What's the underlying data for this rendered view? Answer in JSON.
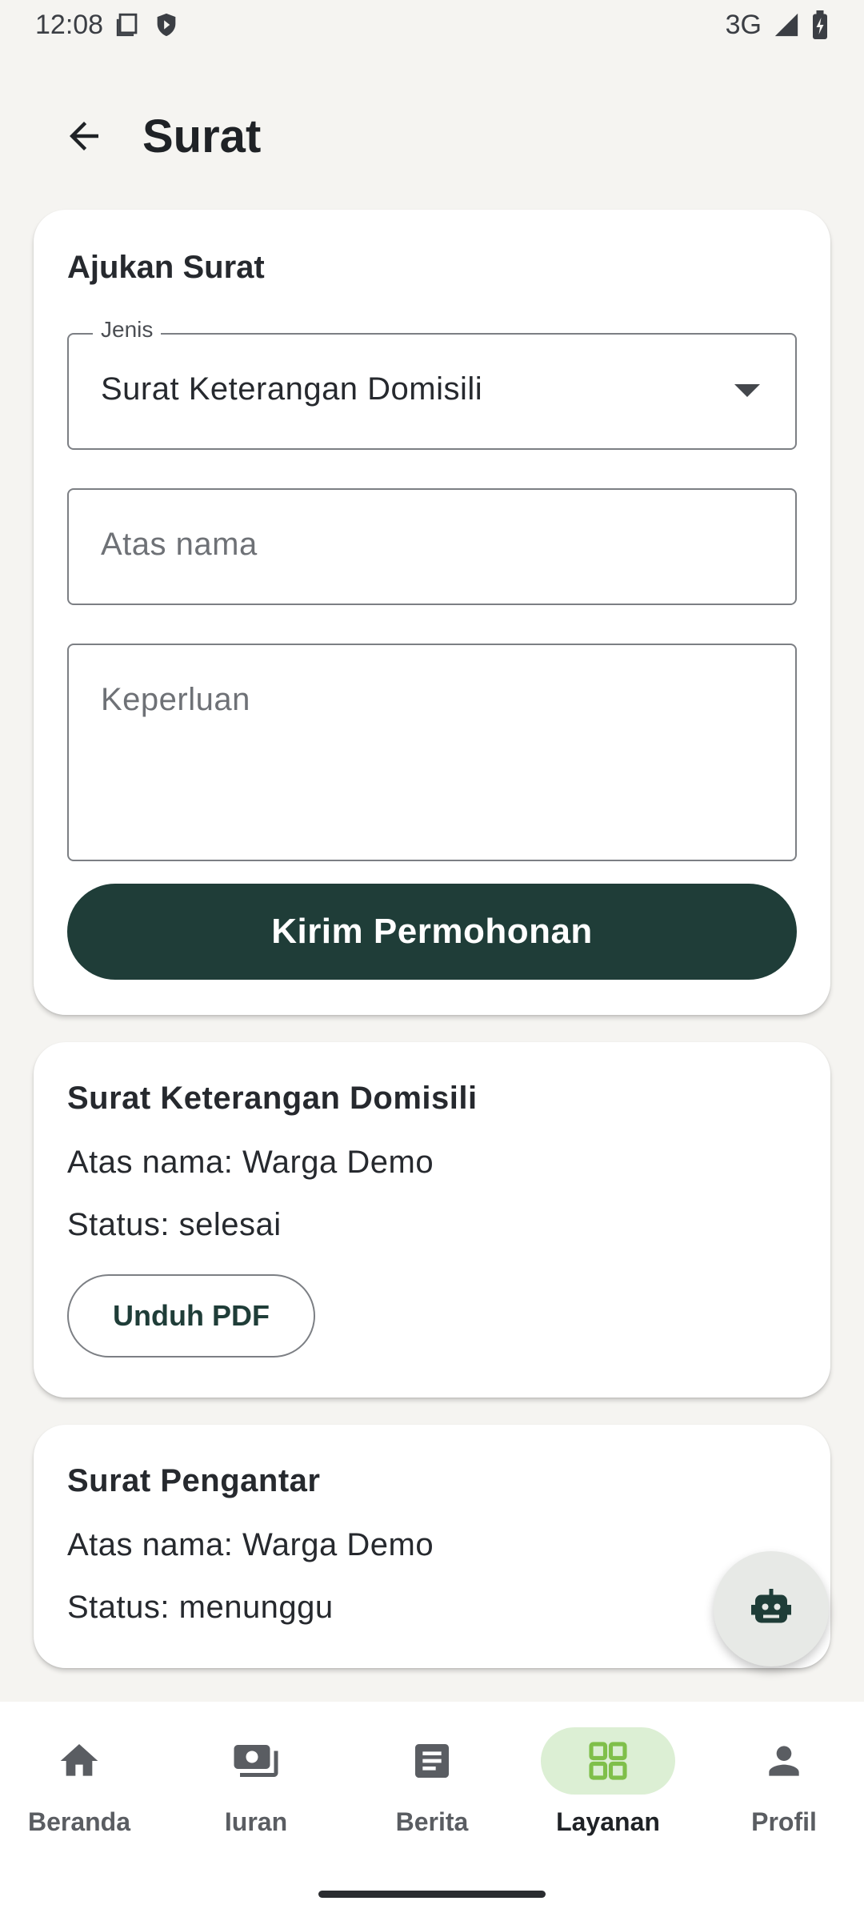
{
  "status_bar": {
    "time": "12:08",
    "network": "3G"
  },
  "appbar": {
    "title": "Surat"
  },
  "form": {
    "heading": "Ajukan Surat",
    "jenis_label": "Jenis",
    "jenis_value": "Surat Keterangan Domisili",
    "atas_nama_placeholder": "Atas nama",
    "keperluan_placeholder": "Keperluan",
    "submit_label": "Kirim Permohonan"
  },
  "requests": [
    {
      "title": "Surat Keterangan Domisili",
      "atas_nama": "Atas nama: Warga Demo",
      "status": "Status: selesai",
      "action_label": "Unduh PDF"
    },
    {
      "title": "Surat Pengantar",
      "atas_nama": "Atas nama: Warga Demo",
      "status": "Status: menunggu"
    }
  ],
  "nav": [
    {
      "label": "Beranda",
      "icon": "home-icon"
    },
    {
      "label": "Iuran",
      "icon": "payments-icon"
    },
    {
      "label": "Berita",
      "icon": "article-icon"
    },
    {
      "label": "Layanan",
      "icon": "grid-icon",
      "active": true
    },
    {
      "label": "Profil",
      "icon": "person-icon"
    }
  ],
  "colors": {
    "primary": "#1f3d38",
    "active_nav_bg": "#dcefd4",
    "active_nav_icon": "#7fbf4a",
    "background": "#f5f4f1"
  }
}
